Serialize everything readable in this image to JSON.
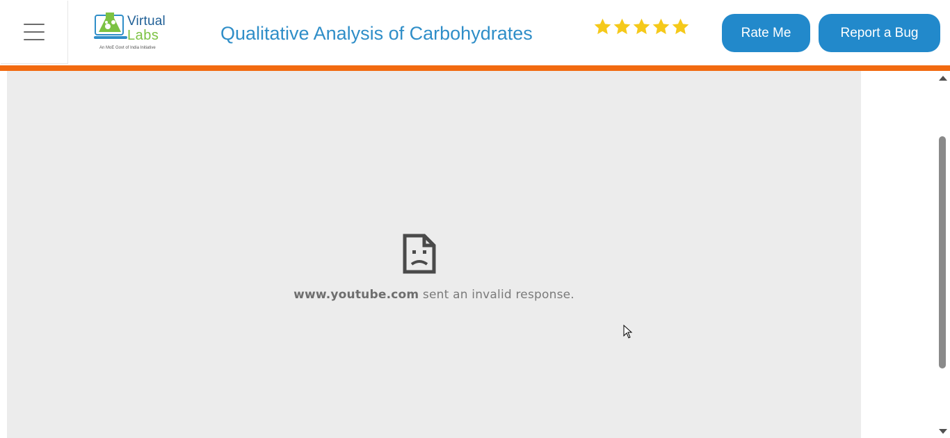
{
  "header": {
    "menu_icon": "hamburger-menu-icon",
    "logo": {
      "word1": "Virtual",
      "word2": "Labs",
      "tagline": "An MoE Govt of India Initiative"
    },
    "title": "Qualitative Analysis of Carbohydrates",
    "rating": {
      "stars": 5,
      "max": 5,
      "icon": "star-icon"
    },
    "rate_button": "Rate Me",
    "bug_button": "Report a Bug"
  },
  "embed": {
    "error_icon": "sad-document-icon",
    "error_host": "www.youtube.com",
    "error_text": " sent an invalid response."
  },
  "colors": {
    "accent_bar": "#f26a10",
    "title": "#2f8ec8",
    "button_bg": "#2289cb",
    "star": "#f5c91a",
    "frame_bg": "#ececec"
  }
}
